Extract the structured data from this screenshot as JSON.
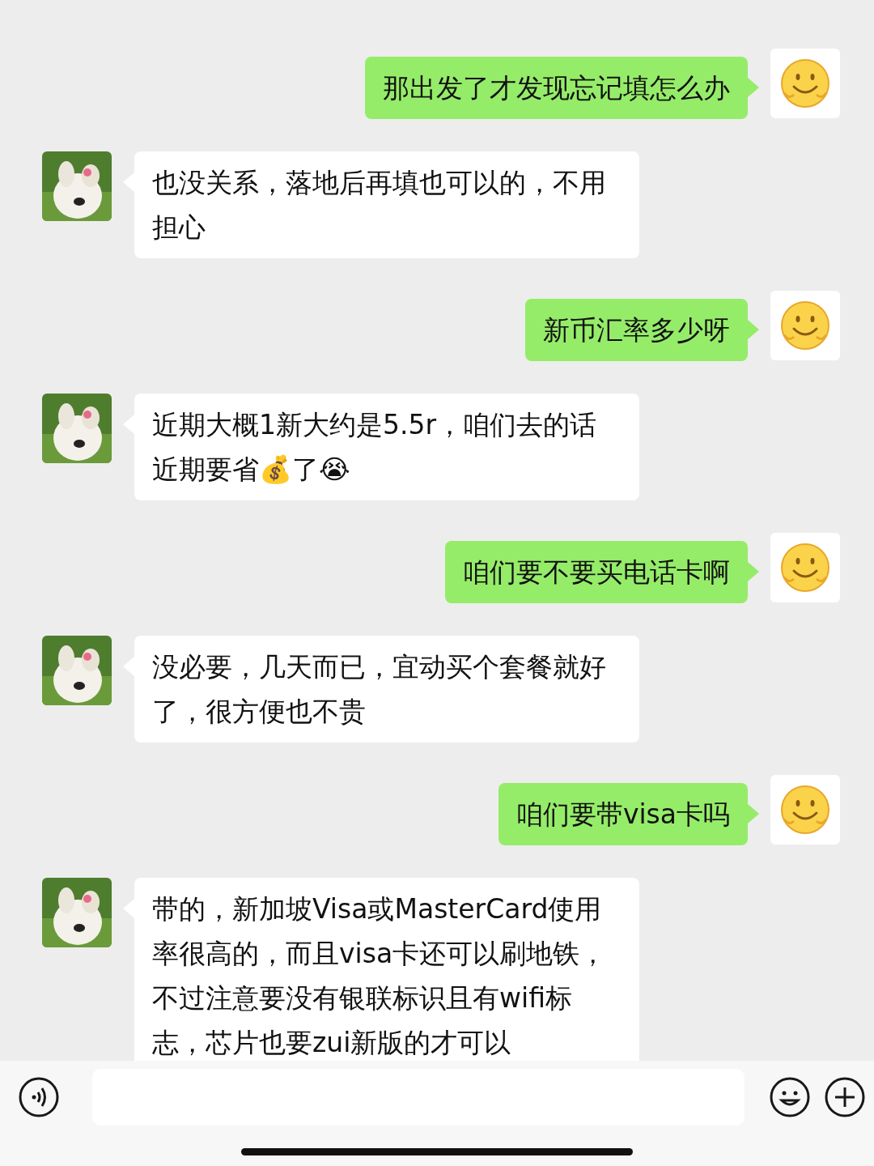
{
  "messages": [
    {
      "kind": "sent",
      "text": "那出发了才发现忘记填怎么办"
    },
    {
      "kind": "received",
      "text": "也没关系，落地后再填也可以的，不用担心"
    },
    {
      "kind": "sent",
      "text": "新币汇率多少呀"
    },
    {
      "kind": "received",
      "text": "近期大概1新大约是5.5r，咱们去的话近期要省💰了😭"
    },
    {
      "kind": "sent",
      "text": "咱们要不要买电话卡啊"
    },
    {
      "kind": "received",
      "text": "没必要，几天而已，宜动买个套餐就好了，很方便也不贵"
    },
    {
      "kind": "sent",
      "text": "咱们要带visa卡吗"
    },
    {
      "kind": "received",
      "text": "带的，新加坡Visa或MasterCard使用率很高的，而且visa卡还可以刷地铁，不过注意要没有银联标识且有wifi标志，芯片也要zui新版的才可以"
    }
  ]
}
